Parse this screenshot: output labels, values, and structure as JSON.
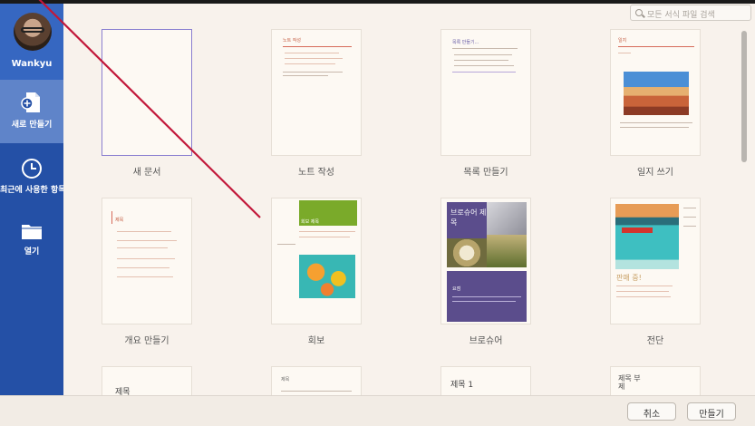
{
  "sidebar": {
    "profile_name": "Wankyu",
    "items": [
      {
        "label": "새로 만들기",
        "icon": "new-document-icon",
        "active": true
      },
      {
        "label": "최근에 사용한 항목",
        "icon": "clock-icon",
        "active": false
      },
      {
        "label": "열기",
        "icon": "folder-icon",
        "active": false
      }
    ]
  },
  "search": {
    "placeholder": "모든 서식 파일 검색"
  },
  "templates": [
    {
      "caption": "새 문서"
    },
    {
      "caption": "노트 작성",
      "heading": "노트 작성"
    },
    {
      "caption": "목록 만들기",
      "heading": "목록 만들기..."
    },
    {
      "caption": "일지 쓰기",
      "heading": "일지"
    },
    {
      "caption": "개요 만들기",
      "heading": "제목"
    },
    {
      "caption": "회보",
      "heading": "회보 제목"
    },
    {
      "caption": "브로슈어",
      "heading": "브로슈어 제목",
      "subheading": "요점"
    },
    {
      "caption": "전단",
      "heading": "판매 중!"
    },
    {
      "caption": "",
      "heading": "제목"
    },
    {
      "caption": "",
      "heading": "제목"
    },
    {
      "caption": "",
      "heading": "제목 1"
    },
    {
      "caption": "",
      "heading": "제목 부제"
    }
  ],
  "footer": {
    "cancel_label": "취소",
    "create_label": "만들기"
  },
  "colors": {
    "sidebar": "#2450a6",
    "sidebar_active": "#5f84c9",
    "accent_green": "#7aaa2a",
    "accent_purple": "#5b4d8c",
    "annotation": "#c2183a"
  }
}
